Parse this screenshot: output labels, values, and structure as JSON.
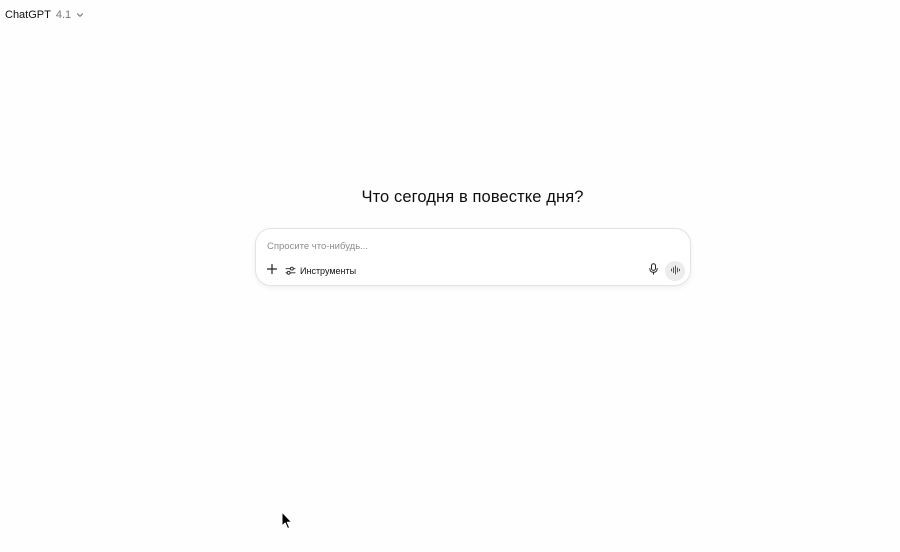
{
  "header": {
    "model_name": "ChatGPT",
    "model_version": "4.1",
    "chevron_icon": "chevron-down-icon"
  },
  "main": {
    "headline": "Что сегодня в повестке дня?"
  },
  "composer": {
    "placeholder": "Спросите что-нибудь...",
    "value": "",
    "add_icon": "plus-icon",
    "tools_icon": "sliders-icon",
    "tools_label": "Инструменты",
    "mic_icon": "microphone-icon",
    "voice_icon": "voice-waveform-icon"
  },
  "colors": {
    "background": "#fefefe",
    "composer_border": "#e3e3e3",
    "voice_button_bg": "#ececec",
    "muted_text": "#7a7a7a"
  }
}
